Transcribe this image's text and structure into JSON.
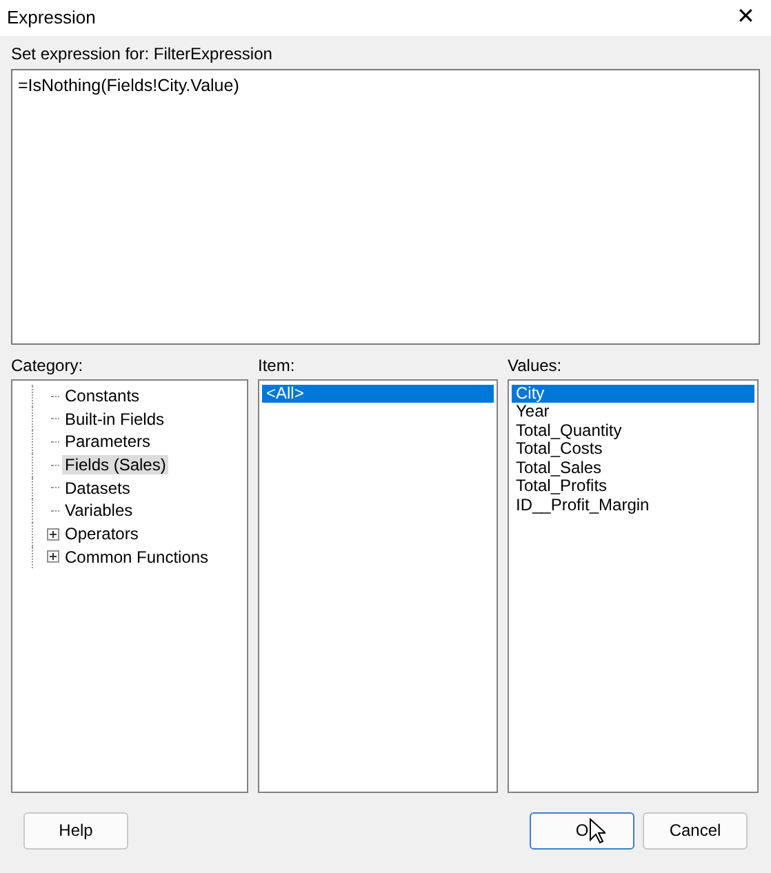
{
  "window": {
    "title": "Expression",
    "close_glyph": "✕"
  },
  "expression": {
    "label": "Set expression for: FilterExpression",
    "value": "=IsNothing(Fields!City.Value)"
  },
  "category": {
    "label": "Category:",
    "items": [
      {
        "label": "Constants",
        "expandable": false,
        "selected": false
      },
      {
        "label": "Built-in Fields",
        "expandable": false,
        "selected": false
      },
      {
        "label": "Parameters",
        "expandable": false,
        "selected": false
      },
      {
        "label": "Fields (Sales)",
        "expandable": false,
        "selected": true
      },
      {
        "label": "Datasets",
        "expandable": false,
        "selected": false
      },
      {
        "label": "Variables",
        "expandable": false,
        "selected": false
      },
      {
        "label": "Operators",
        "expandable": true,
        "selected": false
      },
      {
        "label": "Common Functions",
        "expandable": true,
        "selected": false
      }
    ]
  },
  "item": {
    "label": "Item:",
    "items": [
      {
        "label": "<All>",
        "selected": true
      }
    ]
  },
  "values": {
    "label": "Values:",
    "items": [
      {
        "label": "City",
        "selected": true
      },
      {
        "label": "Year",
        "selected": false
      },
      {
        "label": "Total_Quantity",
        "selected": false
      },
      {
        "label": "Total_Costs",
        "selected": false
      },
      {
        "label": "Total_Sales",
        "selected": false
      },
      {
        "label": "Total_Profits",
        "selected": false
      },
      {
        "label": "ID__Profit_Margin",
        "selected": false
      }
    ]
  },
  "buttons": [
    {
      "label": "Help",
      "kind": "help",
      "focused": false
    },
    {
      "label": "O",
      "kind": "ok",
      "focused": true
    },
    {
      "label": "Cancel",
      "kind": "cancel",
      "focused": false
    }
  ]
}
